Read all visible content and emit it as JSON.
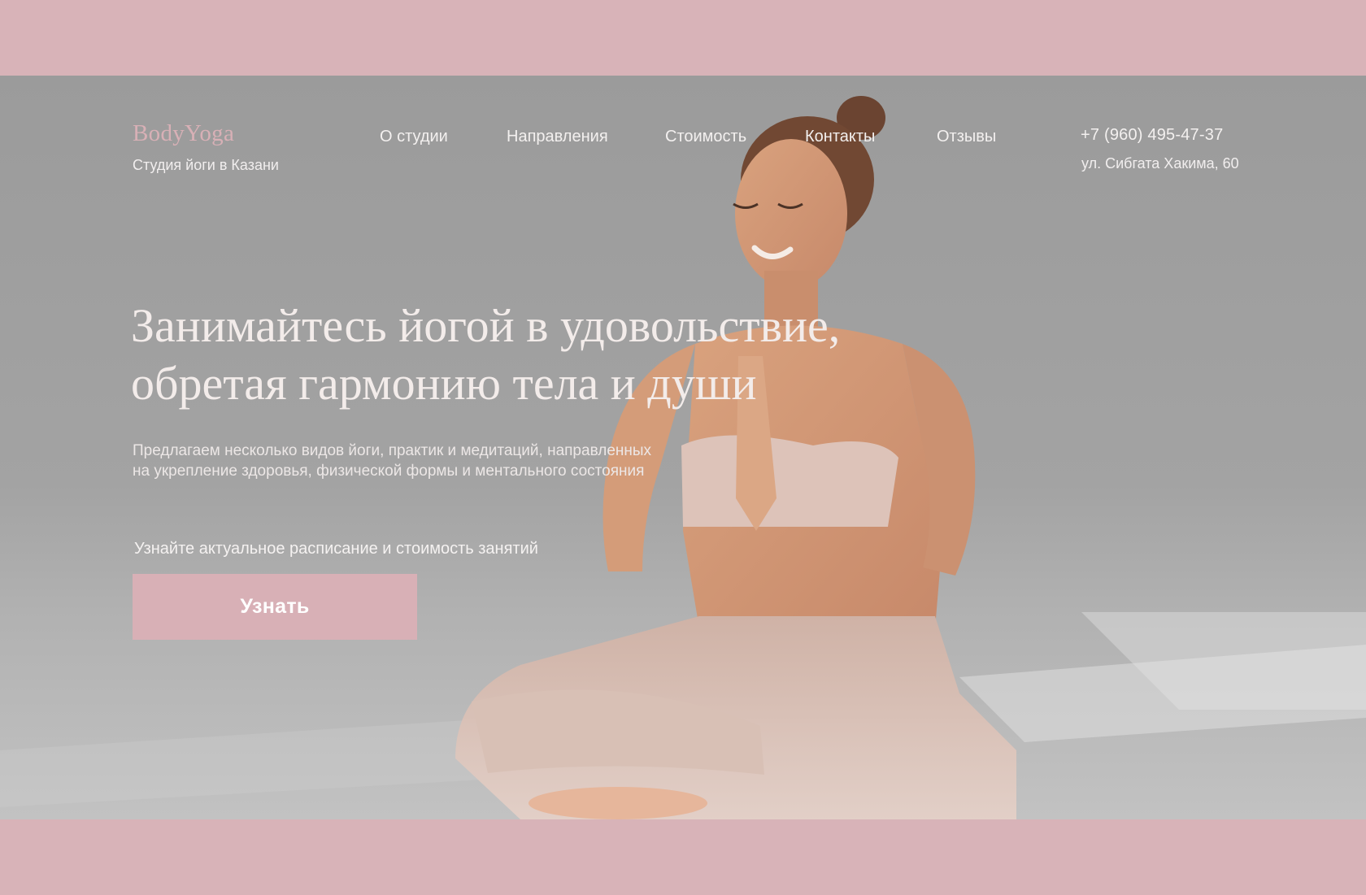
{
  "brand": {
    "name": "BodyYoga",
    "tagline": "Студия йоги в Казани"
  },
  "nav": {
    "items": [
      {
        "label": "О студии"
      },
      {
        "label": "Направления"
      },
      {
        "label": "Стоимость"
      },
      {
        "label": "Контакты"
      },
      {
        "label": "Отзывы"
      }
    ]
  },
  "contacts": {
    "phone": "+7 (960) 495-47-37",
    "address": "ул. Сибгата Хакима, 60"
  },
  "hero": {
    "headline_line1": "Занимайтесь йогой в удовольствие,",
    "headline_line2": "обретая гармонию тела и души",
    "subtext_line1": "Предлагаем несколько видов йоги, практик и медитаций, направленных",
    "subtext_line2": "на укрепление здоровья, физической формы и ментального состояния",
    "cta_caption": "Узнайте актуальное расписание и стоимость занятий",
    "cta_label": "Узнать",
    "image_icon": "yoga-woman-meditating-photo"
  },
  "colors": {
    "accent": "#d8b0b6",
    "frame": "#d8b3b8",
    "overlay_text": "#f3ecea"
  }
}
